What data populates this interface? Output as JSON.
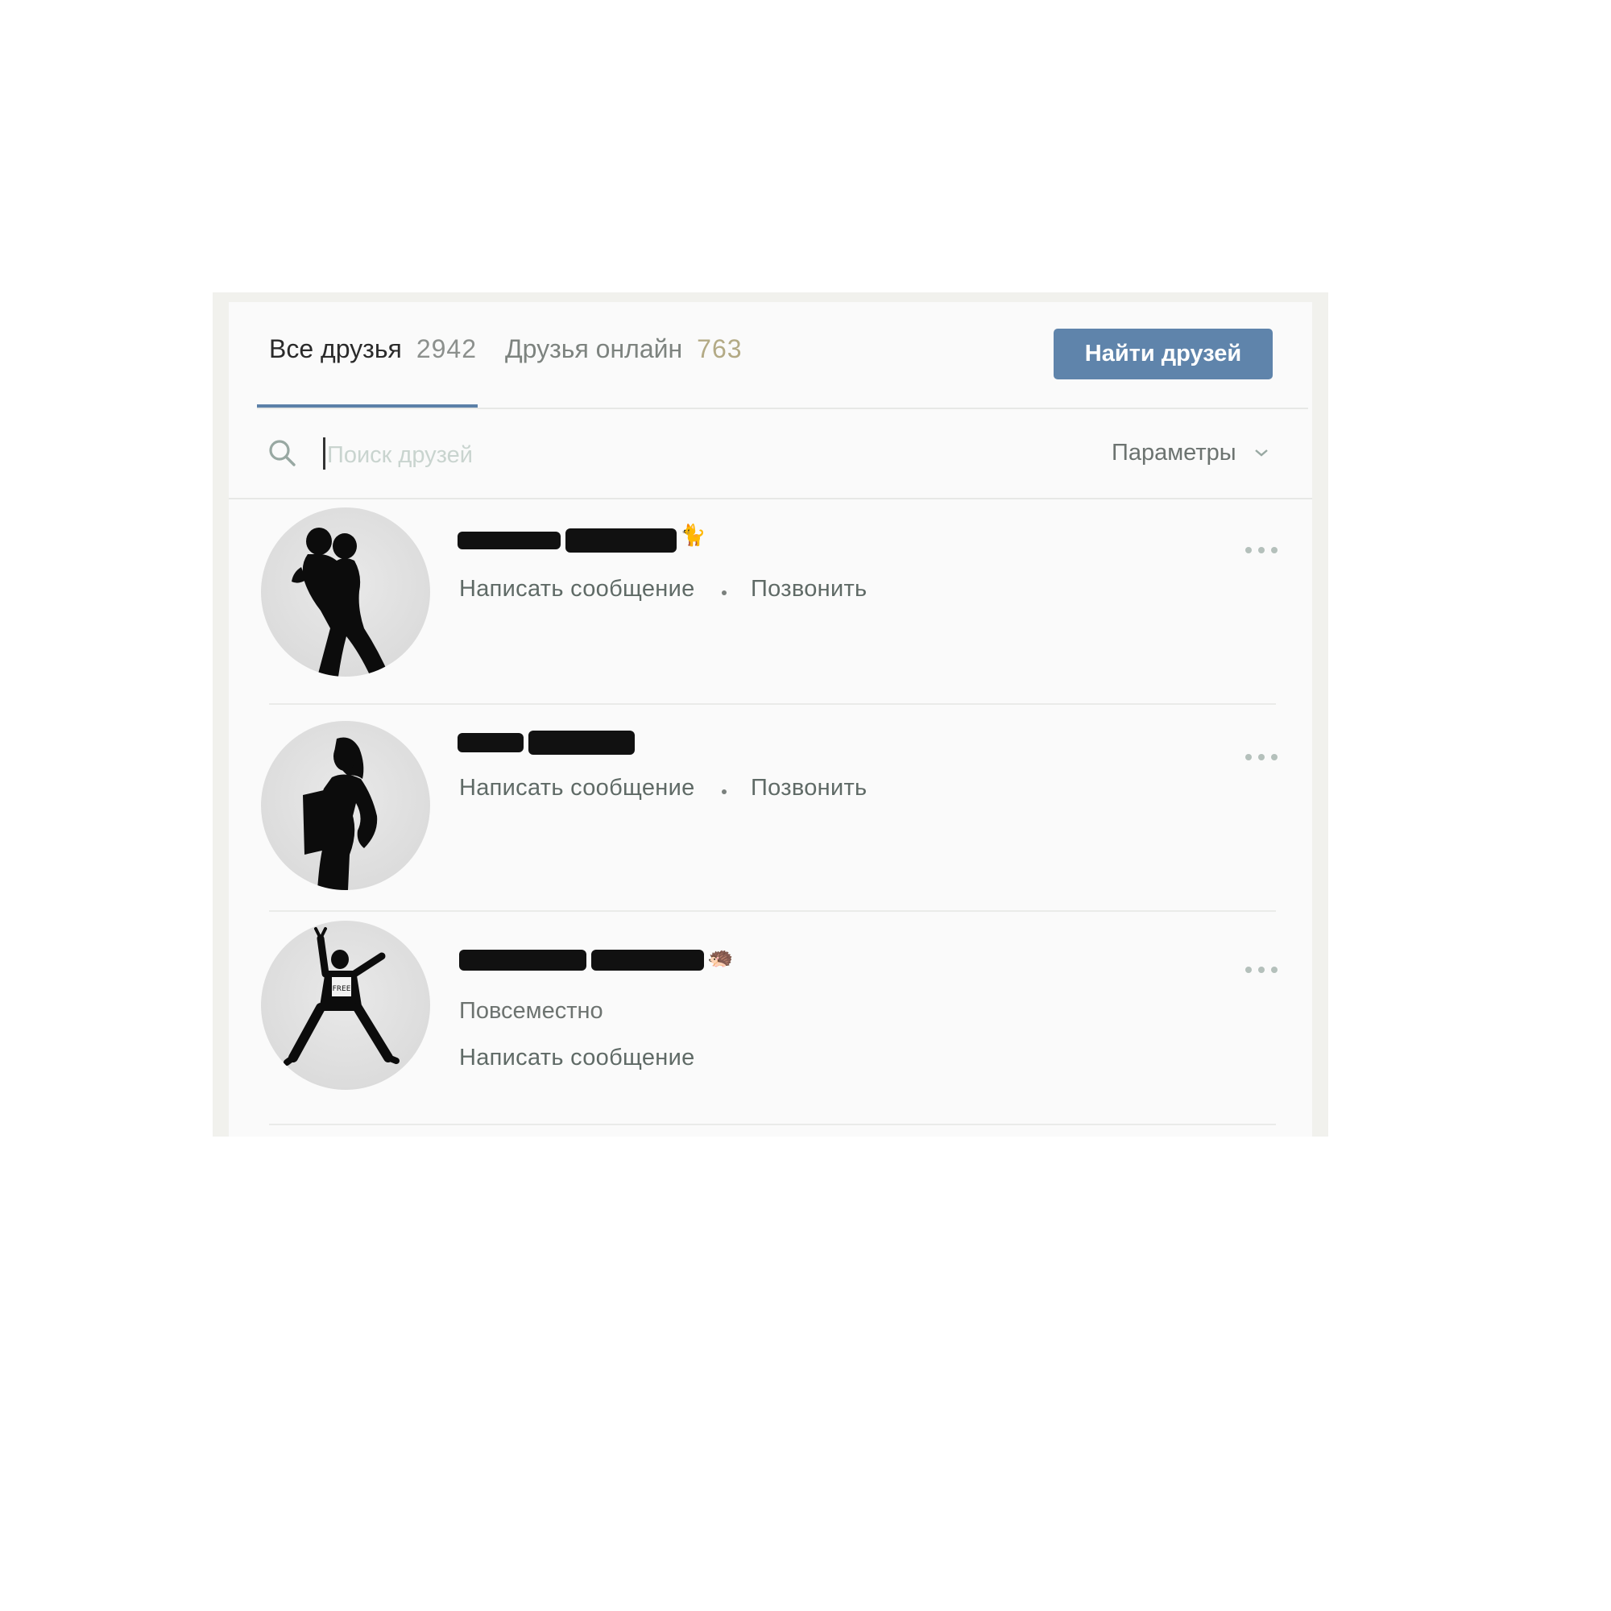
{
  "tabs": {
    "all_label": "Все друзья",
    "all_count": "2942",
    "online_label": "Друзья онлайн",
    "online_count": "763"
  },
  "find_button": "Найти друзей",
  "search": {
    "placeholder": "Поиск друзей",
    "params_label": "Параметры"
  },
  "friends": [
    {
      "emoji": "🐈",
      "status": "",
      "message_label": "Написать сообщение",
      "call_label": "Позвонить"
    },
    {
      "emoji": "",
      "status": "",
      "message_label": "Написать сообщение",
      "call_label": "Позвонить"
    },
    {
      "emoji": "🦔",
      "status": "Повсеместно",
      "message_label": "Написать сообщение",
      "call_label": ""
    }
  ],
  "avatar_print_text": "FREE",
  "colors": {
    "accent": "#5b80a8",
    "button_bg": "#5f84ab",
    "online_count": "#b3aa85",
    "link_text": "#5f6a66"
  }
}
